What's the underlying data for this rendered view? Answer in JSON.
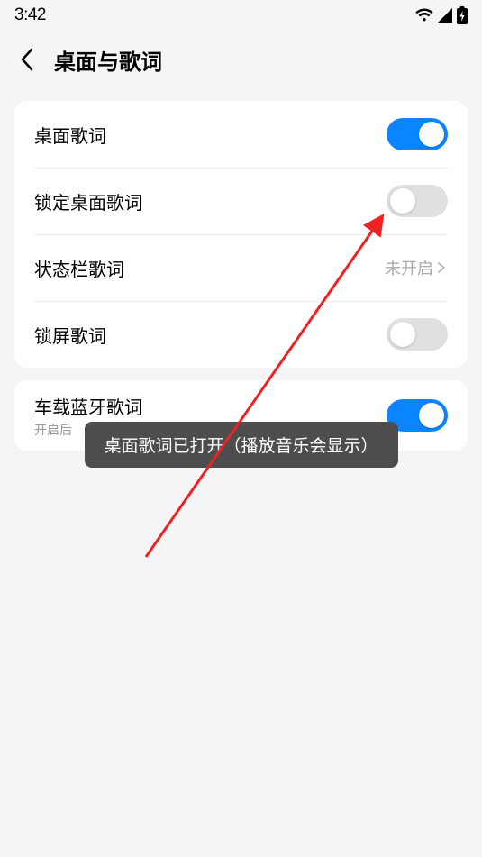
{
  "status": {
    "time": "3:42"
  },
  "nav": {
    "title": "桌面与歌词"
  },
  "group1": {
    "items": [
      {
        "label": "桌面歌词",
        "toggle": true
      },
      {
        "label": "锁定桌面歌词",
        "toggle": false
      },
      {
        "label": "状态栏歌词",
        "value": "未开启"
      },
      {
        "label": "锁屏歌词",
        "toggle": false
      }
    ]
  },
  "group2": {
    "items": [
      {
        "label": "车载蓝牙歌词",
        "sub": "开启后",
        "toggle": true
      }
    ]
  },
  "toast": {
    "text": "桌面歌词已打开（播放音乐会显示）"
  }
}
